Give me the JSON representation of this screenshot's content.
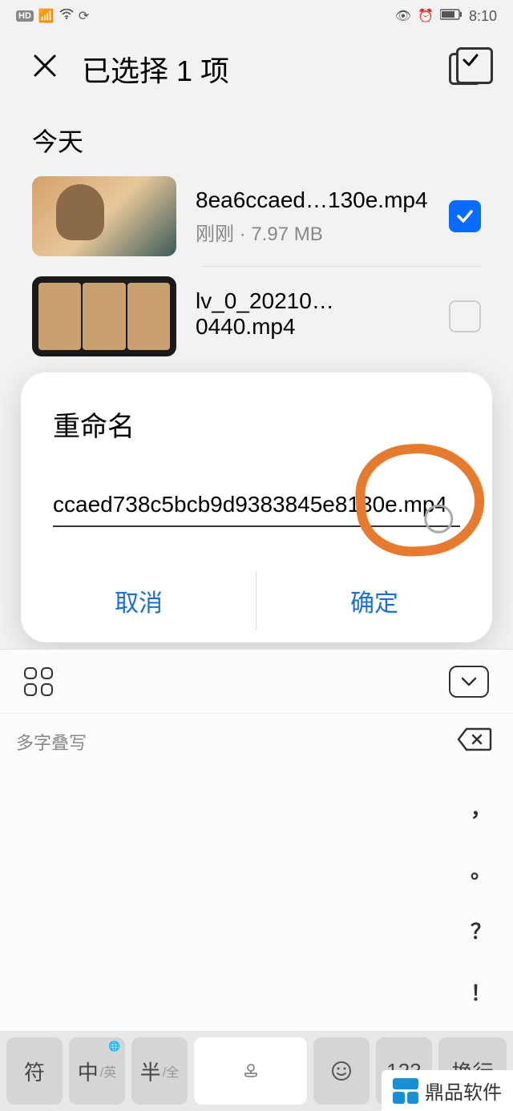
{
  "status": {
    "time": "8:10"
  },
  "header": {
    "title": "已选择 1 项"
  },
  "section": {
    "today": "今天"
  },
  "files": [
    {
      "name": "8ea6ccaed…130e.mp4",
      "meta": "刚刚 · 7.97 MB",
      "checked": true
    },
    {
      "name": "lv_0_20210…0440.mp4",
      "meta": "",
      "checked": false
    }
  ],
  "modal": {
    "title": "重命名",
    "input_value": "ccaed738c5bcb9d9383845e8130e.mp4",
    "cancel": "取消",
    "confirm": "确定"
  },
  "ime": {
    "candidate": "多字叠写",
    "side": {
      "comma": "，",
      "period": "。",
      "question": "？",
      "exclaim": "！"
    },
    "keys": {
      "sym": "符",
      "zh": "中",
      "zh_sub": "/英",
      "half": "半",
      "half_sub": "/全",
      "num": "123",
      "enter": "换行",
      "globe": "🌐"
    }
  },
  "watermark": {
    "text": "鼎品软件"
  }
}
